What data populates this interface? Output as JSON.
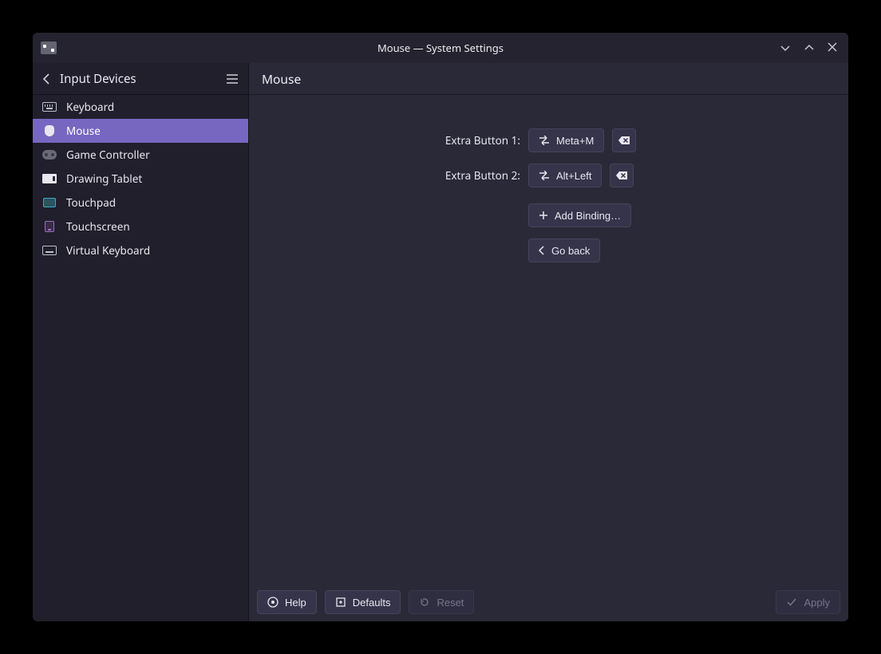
{
  "window": {
    "title": "Mouse — System Settings"
  },
  "sidebar": {
    "title": "Input Devices",
    "items": [
      {
        "label": "Keyboard",
        "icon": "keyboard"
      },
      {
        "label": "Mouse",
        "icon": "mouse",
        "selected": true
      },
      {
        "label": "Game Controller",
        "icon": "controller"
      },
      {
        "label": "Drawing Tablet",
        "icon": "tablet"
      },
      {
        "label": "Touchpad",
        "icon": "touchpad"
      },
      {
        "label": "Touchscreen",
        "icon": "touchscreen"
      },
      {
        "label": "Virtual Keyboard",
        "icon": "vkeyboard"
      }
    ]
  },
  "main": {
    "title": "Mouse",
    "bindings": [
      {
        "label": "Extra Button 1:",
        "shortcut": "Meta+M"
      },
      {
        "label": "Extra Button 2:",
        "shortcut": "Alt+Left"
      }
    ],
    "add_binding_label": "Add Binding…",
    "go_back_label": "Go back"
  },
  "footer": {
    "help_label": "Help",
    "defaults_label": "Defaults",
    "reset_label": "Reset",
    "apply_label": "Apply"
  }
}
